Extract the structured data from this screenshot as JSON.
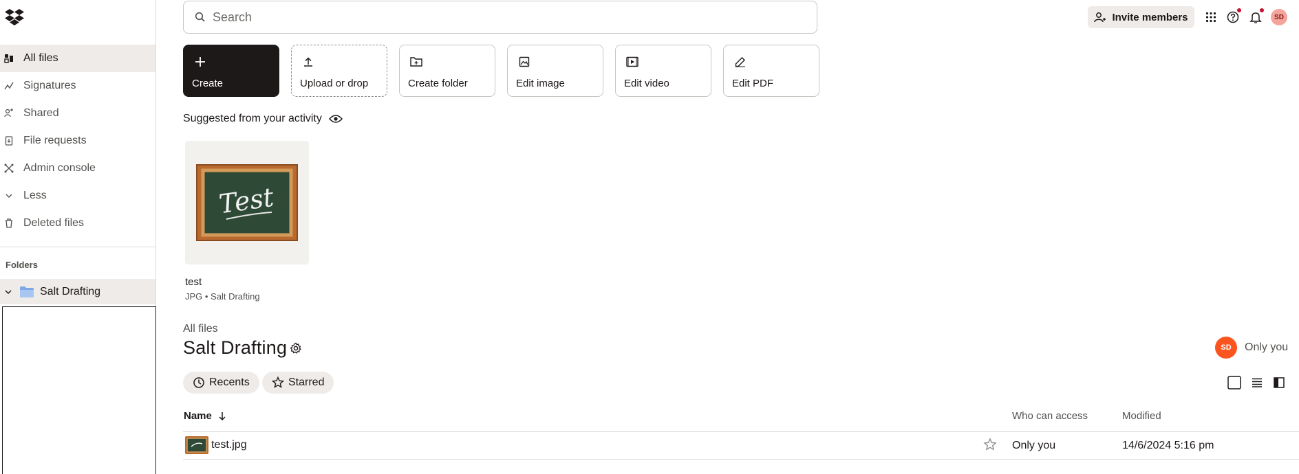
{
  "sidebar": {
    "items": [
      {
        "label": "All files",
        "icon": "all-files-icon"
      },
      {
        "label": "Signatures",
        "icon": "signature-icon"
      },
      {
        "label": "Shared",
        "icon": "shared-icon"
      },
      {
        "label": "File requests",
        "icon": "file-request-icon"
      },
      {
        "label": "Admin console",
        "icon": "admin-icon"
      },
      {
        "label": "Less",
        "icon": "chevron-down-icon"
      },
      {
        "label": "Deleted files",
        "icon": "trash-icon"
      }
    ],
    "folders_heading": "Folders",
    "folder": "Salt Drafting"
  },
  "topbar": {
    "search_placeholder": "Search",
    "invite_label": "Invite members",
    "avatar_initials": "SD"
  },
  "tiles": [
    {
      "label": "Create",
      "icon": "plus-icon"
    },
    {
      "label": "Upload or drop",
      "icon": "upload-icon"
    },
    {
      "label": "Create folder",
      "icon": "folder-add-icon"
    },
    {
      "label": "Edit image",
      "icon": "image-edit-icon"
    },
    {
      "label": "Edit video",
      "icon": "video-edit-icon"
    },
    {
      "label": "Edit PDF",
      "icon": "pdf-edit-icon"
    }
  ],
  "suggested": {
    "title": "Suggested from your activity",
    "card": {
      "name": "test",
      "meta": "JPG • Salt Drafting",
      "thumb_text": "Test"
    }
  },
  "folder_view": {
    "breadcrumb": "All files",
    "title": "Salt Drafting",
    "owner_initials": "SD",
    "access_label": "Only you",
    "chips": [
      "Recents",
      "Starred"
    ]
  },
  "table": {
    "columns": {
      "name": "Name",
      "access": "Who can access",
      "modified": "Modified"
    },
    "rows": [
      {
        "name": "test.jpg",
        "access": "Only you",
        "modified": "14/6/2024 5:16 pm"
      }
    ]
  },
  "colors": {
    "accent": "#1e1919",
    "avatar": "#fa551e",
    "notify": "#c8102e",
    "chip": "#eeebe8"
  }
}
